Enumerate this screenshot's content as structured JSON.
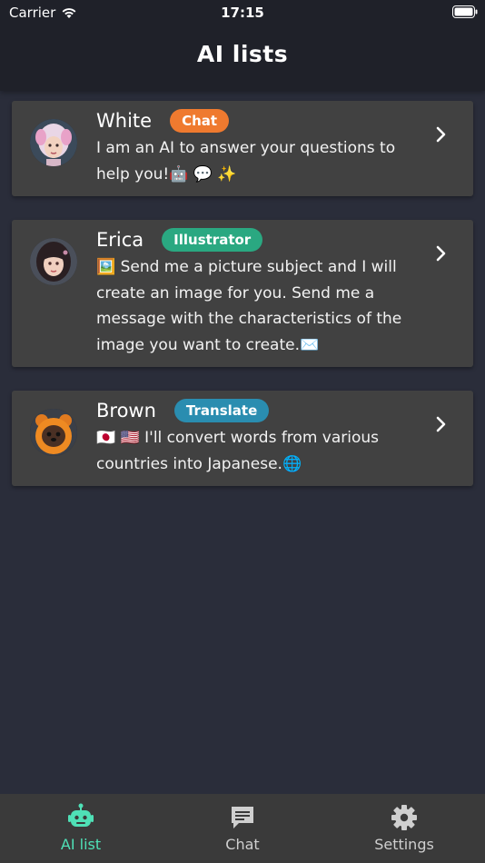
{
  "status_bar": {
    "carrier": "Carrier",
    "time": "17:15"
  },
  "header": {
    "title": "AI lists"
  },
  "ai_list": [
    {
      "name": "White",
      "badge": "Chat",
      "badge_color": "#ef7a2f",
      "description": "I am an AI to answer your questions to help you!🤖 💬 ✨"
    },
    {
      "name": "Erica",
      "badge": "Illustrator",
      "badge_color": "#2aa881",
      "description": "🖼️ Send me a picture subject and I will create an image for you. Send me a message with the characteristics of the image you want to create.✉️"
    },
    {
      "name": "Brown",
      "badge": "Translate",
      "badge_color": "#2a8db0",
      "description": "🇯🇵 🇺🇸 I'll convert words from various countries into Japanese.🌐"
    }
  ],
  "tabs": [
    {
      "label": "AI list",
      "icon": "robot-icon",
      "active": true
    },
    {
      "label": "Chat",
      "icon": "chat-bubble-icon",
      "active": false
    },
    {
      "label": "Settings",
      "icon": "gear-icon",
      "active": false
    }
  ],
  "colors": {
    "accent": "#4fe0b6",
    "background": "#2a2d3a",
    "card": "#414141",
    "header": "#1f2129",
    "tabbar": "#3a3a3a"
  }
}
